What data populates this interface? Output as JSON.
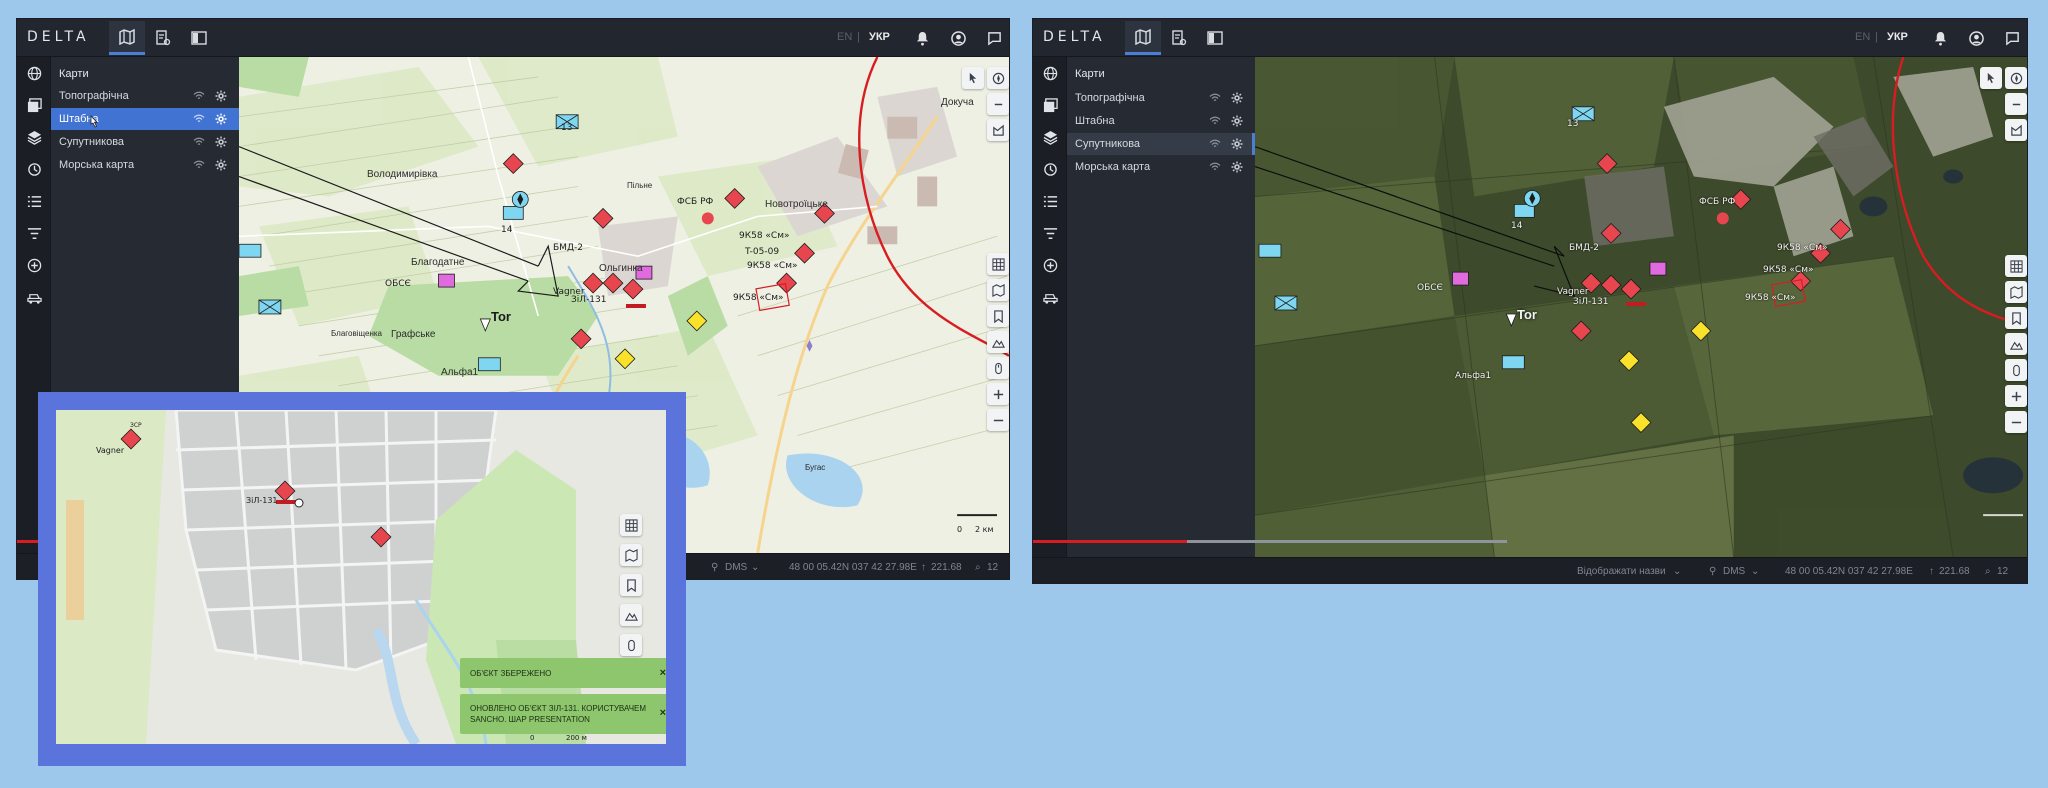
{
  "app": {
    "logo": "DELTA",
    "lang_en": "EN",
    "lang_sep": "|",
    "lang_ukr": "УКР"
  },
  "panel": {
    "title": "Карти",
    "layers": [
      {
        "label": "Топографічна"
      },
      {
        "label": "Штабна"
      },
      {
        "label": "Супутникова"
      },
      {
        "label": "Морська карта"
      }
    ]
  },
  "map_labels": {
    "volodymyrivka": "Володимирівка",
    "novotroitske": "Новотроїцьке",
    "olhynka": "Ольгинка",
    "blahodatne": "Благодатне",
    "hrafske": "Графське",
    "alfa1": "Альфа1",
    "obse": "ОБСЄ",
    "fsb": "ФСБ РФ",
    "bmd2": "БМД-2",
    "zpl131": "ЗіЛ-131",
    "vagner": "Vagner",
    "t0509": "T-05-09",
    "k58_1": "9К58 «См»",
    "k58_2": "9К58 «См»",
    "k58_3": "9К58 «См»",
    "tor": "Tor",
    "zsr": "ЗСР",
    "n13": "13",
    "n14": "14",
    "dokuch": "Докуча",
    "bohdanivka": "Благовіщенка",
    "prub": "Пільне",
    "bugas": "Бугас",
    "scale": "2 км",
    "scale0": "0"
  },
  "status": {
    "show_names": "Відображати назви",
    "coord_format": "DMS",
    "coords": "48 00 05.42N 037 42 27.98E",
    "elevation": "221.68",
    "zoom": "12"
  },
  "inset": {
    "toast1": "ОБ'ЄКТ ЗБЕРЕЖЕНО",
    "toast2": "ОНОВЛЕНО ОБ'ЄКТ ЗІЛ-131. КОРИСТУВАЧЕМ SANCHO. ШАР PRESENTATION",
    "close": "×",
    "scale": "200 м",
    "scale0": "0",
    "vagner": "Vagner",
    "zil": "ЗіЛ-131",
    "zsr": "ЗСР"
  },
  "colors": {
    "accent": "#4173d2",
    "enemy": "#e8464f",
    "frontline": "#d81c22",
    "friendly": "#7fd6f0",
    "toast": "#8dc66c",
    "inset_frame": "#5b74dc"
  }
}
